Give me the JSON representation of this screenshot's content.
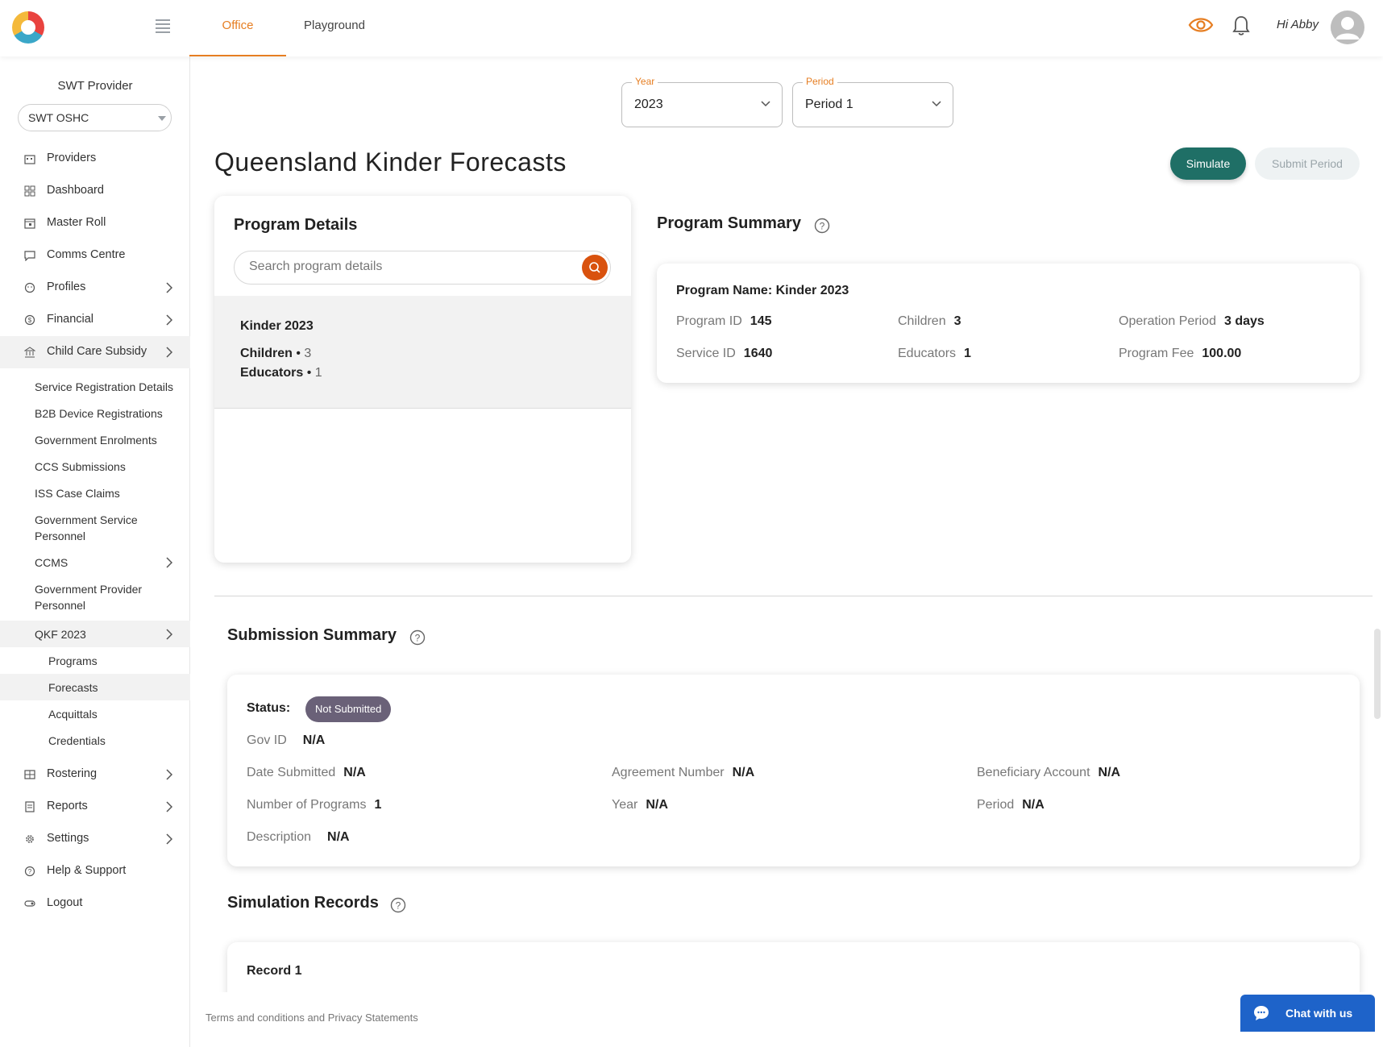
{
  "header": {
    "tabs": [
      {
        "label": "Office",
        "active": true
      },
      {
        "label": "Playground",
        "active": false
      }
    ],
    "greeting": "Hi Abby",
    "accent_color": "#e67e22"
  },
  "sidebar": {
    "provider_label": "SWT Provider",
    "provider_value": "SWT OSHC",
    "items": [
      {
        "label": "Providers",
        "icon": "building-icon"
      },
      {
        "label": "Dashboard",
        "icon": "grid-icon"
      },
      {
        "label": "Master Roll",
        "icon": "calendar-icon"
      },
      {
        "label": "Comms Centre",
        "icon": "chat-icon"
      },
      {
        "label": "Profiles",
        "icon": "face-icon"
      },
      {
        "label": "Financial",
        "icon": "dollar-icon"
      },
      {
        "label": "Child Care Subsidy",
        "icon": "bank-icon"
      }
    ],
    "ccs_subitems": [
      "Service Registration Details",
      "B2B Device Registrations",
      "Government Enrolments",
      "CCS Submissions",
      "ISS Case Claims",
      "Government Service Personnel",
      "CCMS",
      "Government Provider Personnel",
      "QKF 2023"
    ],
    "qkf_subitems": [
      "Programs",
      "Forecasts",
      "Acquittals",
      "Credentials"
    ],
    "bottom_items": [
      {
        "label": "Rostering",
        "icon": "table-icon"
      },
      {
        "label": "Reports",
        "icon": "report-icon"
      },
      {
        "label": "Settings",
        "icon": "gear-icon"
      },
      {
        "label": "Help & Support",
        "icon": "help-icon"
      },
      {
        "label": "Logout",
        "icon": "logout-icon"
      }
    ]
  },
  "filters": {
    "year_label": "Year",
    "year_value": "2023",
    "period_label": "Period",
    "period_value": "Period 1"
  },
  "page": {
    "title": "Queensland Kinder Forecasts",
    "simulate_label": "Simulate",
    "submit_label": "Submit Period"
  },
  "program_details": {
    "title": "Program Details",
    "search_placeholder": "Search program details",
    "item": {
      "name": "Kinder 2023",
      "children_label": "Children",
      "children_value": "3",
      "educators_label": "Educators",
      "educators_value": "1"
    }
  },
  "program_summary": {
    "title": "Program Summary",
    "name_line": "Program Name: Kinder 2023",
    "program_id_label": "Program ID",
    "program_id": "145",
    "children_label": "Children",
    "children": "3",
    "operation_period_label": "Operation Period",
    "operation_period": "3 days",
    "service_id_label": "Service ID",
    "service_id": "1640",
    "educators_label": "Educators",
    "educators": "1",
    "program_fee_label": "Program Fee",
    "program_fee": "100.00"
  },
  "submission_summary": {
    "title": "Submission Summary",
    "status_label": "Status:",
    "status_value": "Not Submitted",
    "gov_id_label": "Gov ID",
    "gov_id": "N/A",
    "date_submitted_label": "Date Submitted",
    "date_submitted": "N/A",
    "agreement_number_label": "Agreement Number",
    "agreement_number": "N/A",
    "beneficiary_account_label": "Beneficiary Account",
    "beneficiary_account": "N/A",
    "num_programs_label": "Number of Programs",
    "num_programs": "1",
    "year_label": "Year",
    "year": "N/A",
    "period_label": "Period",
    "period": "N/A",
    "description_label": "Description",
    "description": "N/A"
  },
  "simulation_records": {
    "title": "Simulation Records",
    "record_title": "Record 1"
  },
  "footer": {
    "terms": "Terms and conditions and Privacy Statements",
    "chat_label": "Chat with us"
  }
}
